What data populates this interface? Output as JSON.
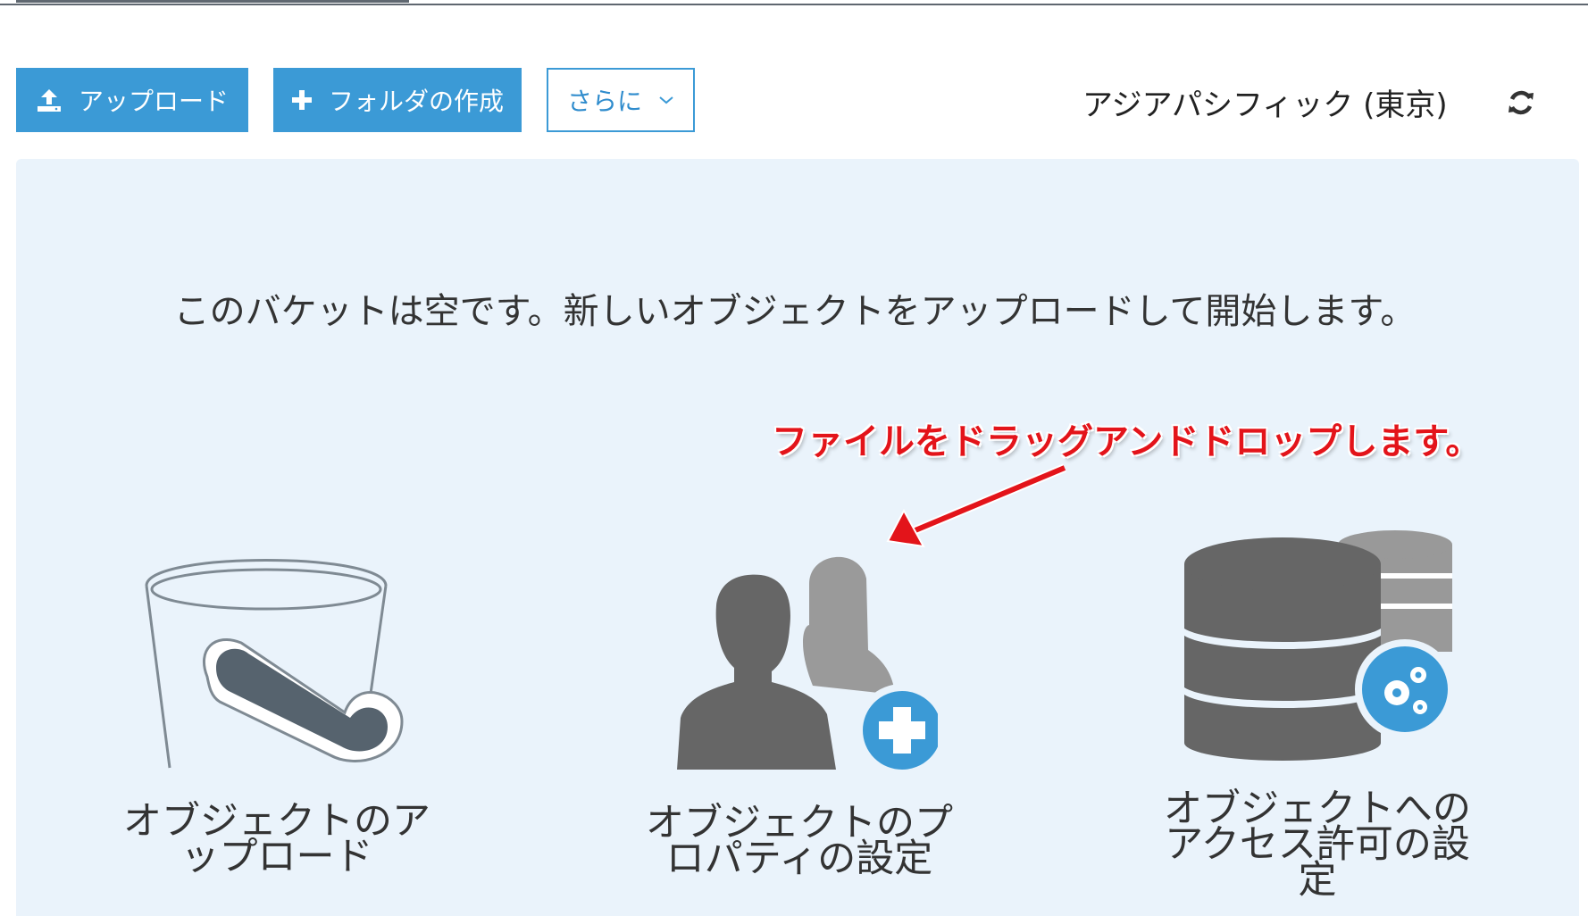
{
  "toolbar": {
    "upload_label": "アップロード",
    "create_folder_label": "フォルダの作成",
    "more_label": "さらに"
  },
  "region": "アジアパシフィック (東京)",
  "empty_state": {
    "message": "このバケットは空です。新しいオブジェクトをアップロードして開始します。",
    "annotation": "ファイルをドラッグアンドドロップします。"
  },
  "features": [
    {
      "label": "オブジェクトのアップロード",
      "icon": "bucket-icon"
    },
    {
      "label": "オブジェクトのプロパティの設定",
      "icon": "users-add-icon"
    },
    {
      "label": "オブジェクトへのアクセス許可の設定",
      "icon": "database-settings-icon"
    }
  ],
  "colors": {
    "primary": "#3b9ad6",
    "panel_bg": "#eaf3fb",
    "annotation": "#e3141a",
    "icon_gray": "#6a6a6a"
  }
}
